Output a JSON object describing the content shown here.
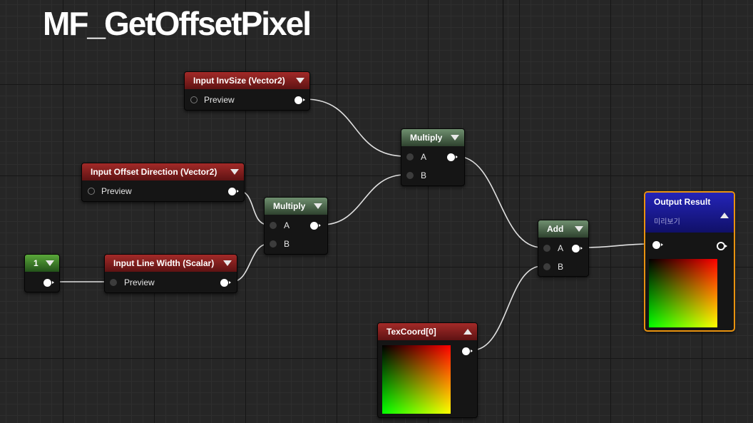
{
  "title": "MF_GetOffsetPixel",
  "nodes": {
    "invsize": {
      "title": "Input InvSize (Vector2)",
      "pin_label": "Preview"
    },
    "offset_dir": {
      "title": "Input Offset Direction (Vector2)",
      "pin_label": "Preview"
    },
    "constant": {
      "title": "1"
    },
    "line_width": {
      "title": "Input Line Width (Scalar)",
      "pin_label": "Preview"
    },
    "multiply_top": {
      "title": "Multiply",
      "pin_a": "A",
      "pin_b": "B"
    },
    "multiply_bottom": {
      "title": "Multiply",
      "pin_a": "A",
      "pin_b": "B"
    },
    "add": {
      "title": "Add",
      "pin_a": "A",
      "pin_b": "B"
    },
    "texcoord": {
      "title": "TexCoord[0]"
    },
    "output": {
      "title": "Output Result",
      "subtitle": "미리보기"
    }
  },
  "colors": {
    "input_header": "#8b2222",
    "math_header": "#4f6a4f",
    "constant_header": "#3d7a2a",
    "output_header": "#1c1c9a",
    "selection_outline": "#e8920f",
    "wire": "#e0e0e0"
  },
  "icons": {
    "collapse": "triangle-down-icon",
    "expand": "triangle-up-icon"
  }
}
